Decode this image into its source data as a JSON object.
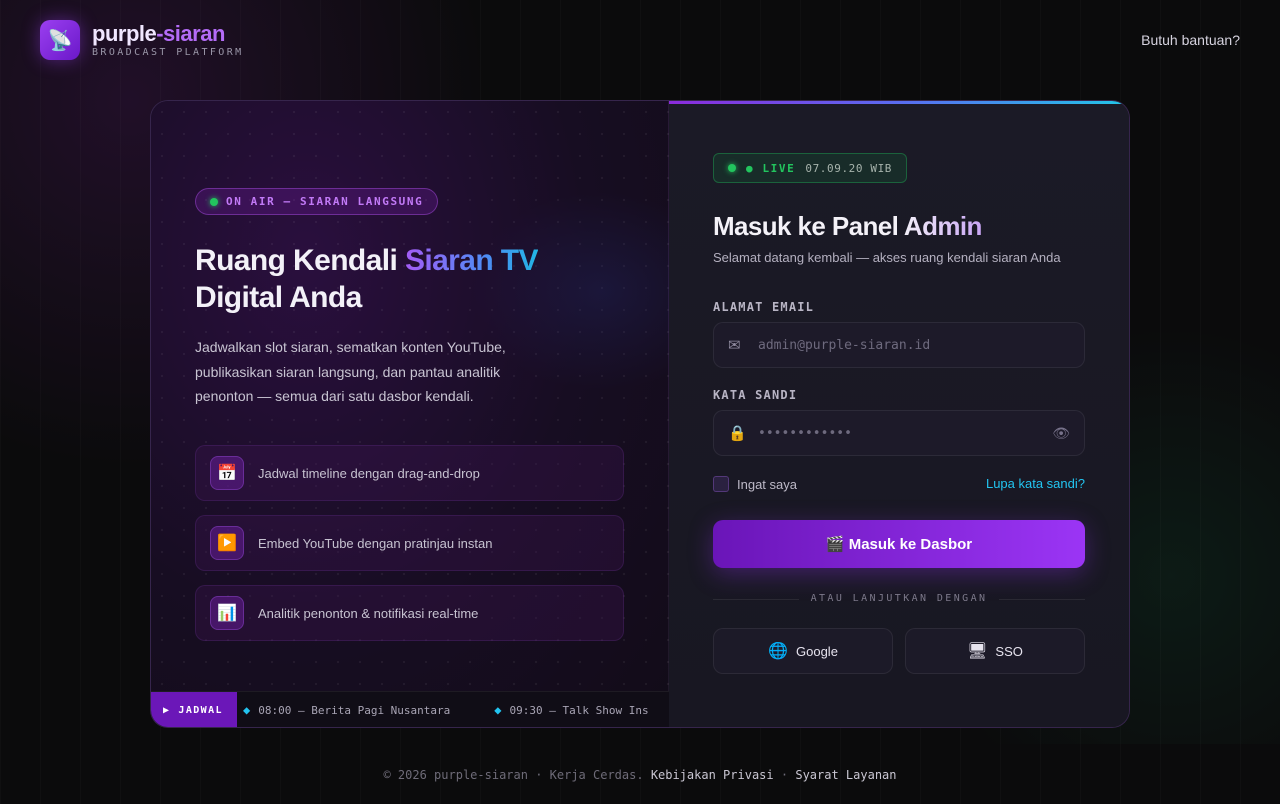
{
  "brand": {
    "name_part1": "purple",
    "name_part2": "-siaran",
    "subtitle": "BROADCAST PLATFORM",
    "logo_icon": "satellite-dish-icon"
  },
  "header": {
    "help_link": "Butuh bantuan?"
  },
  "hero": {
    "badge": "ON AIR — SIARAN LANGSUNG",
    "title_part1": "Ruang Kendali ",
    "title_highlight": "Siaran TV",
    "title_part2": "Digital Anda",
    "description": "Jadwalkan slot siaran, sematkan konten YouTube, publikasikan siaran langsung, dan pantau analitik penonton — semua dari satu dasbor kendali.",
    "features": [
      {
        "icon": "calendar-icon",
        "glyph": "📅",
        "label": "Jadwal timeline dengan drag-and-drop"
      },
      {
        "icon": "play-icon",
        "glyph": "▶️",
        "label": "Embed YouTube dengan pratinjau instan"
      },
      {
        "icon": "bar-chart-icon",
        "glyph": "📊",
        "label": "Analitik penonton & notifikasi real-time"
      }
    ]
  },
  "ticker": {
    "label": "JADWAL",
    "items": [
      "08:00 — Berita Pagi Nusantara",
      "09:30 — Talk Show Ins"
    ]
  },
  "login": {
    "live_label": "● LIVE",
    "live_time": "07.09.20 WIB",
    "title": "Masuk ke Panel Admin",
    "subtitle": "Selamat datang kembali — akses ruang kendali siaran Anda",
    "email_label": "ALAMAT EMAIL",
    "email_placeholder": "admin@purple-siaran.id",
    "password_label": "KATA SANDI",
    "password_placeholder": "••••••••••••",
    "remember_label": "Ingat saya",
    "forgot_link": "Lupa kata sandi?",
    "submit_label": "🎬 Masuk ke Dasbor",
    "divider_text": "ATAU LANJUTKAN DENGAN",
    "sso_buttons": [
      {
        "icon": "globe-icon",
        "glyph": "🌐",
        "label": "Google"
      },
      {
        "icon": "monitor-icon",
        "glyph": "🖥",
        "label": "SSO"
      }
    ]
  },
  "footer": {
    "copyright": "© 2026 purple-siaran · Kerja Cerdas.",
    "privacy": "Kebijakan Privasi",
    "separator": "·",
    "terms": "Syarat Layanan"
  },
  "colors": {
    "accent_purple": "#9b35f5",
    "accent_cyan": "#22c4f0",
    "live_green": "#22c55e",
    "background": "#0b0b0c"
  }
}
